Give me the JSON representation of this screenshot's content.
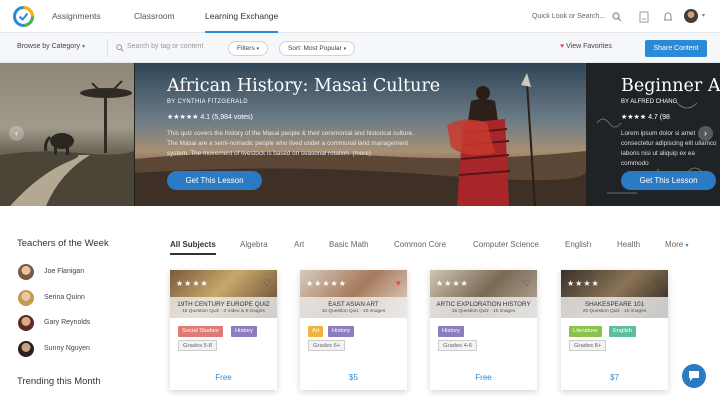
{
  "nav": {
    "tabs": [
      "Assignments",
      "Classroom",
      "Learning Exchange"
    ],
    "search_placeholder": "Quick Look or Search..."
  },
  "toolbar": {
    "browse": "Browse by Category",
    "search_placeholder": "Search by tag or content",
    "filters": "Filters",
    "sort": "Sort: Most Popular",
    "favorites": "View Favorites",
    "share": "Share Content"
  },
  "featured": {
    "title": "African History: Masai Culture",
    "author": "BY CYNTHIA FITZGERALD",
    "rating": "4.1 (5,984 votes)",
    "stars": "★★★★★",
    "description": "This quiz covers the history of the Masai people & their ceremonial and historical culture. The Masai are a semi-nomadic people who lived under a communal land management system. The movement of livestock is based on seasonal rotation. (more)",
    "button": "Get This Lesson",
    "next_title": "Beginner Al",
    "next_author": "BY ALFRED CHANG",
    "next_stars": "★★★★",
    "next_rating": "4.7 (98",
    "next_desc": "Lorem ipsum dolor si amet consectetur adipiscing elit ullamco laboris nisi ut aliquip ex ea commodo",
    "next_button": "Get This Lesson"
  },
  "teachers": {
    "heading": "Teachers of the Week",
    "names": [
      "Joe Flanigan",
      "Serina Quinn",
      "Gary Reynolds",
      "Sunny Nguyen"
    ]
  },
  "trending": {
    "heading": "Trending this Month"
  },
  "subjects": [
    "All Subjects",
    "Algebra",
    "Art",
    "Basic Math",
    "Common Core",
    "Computer Science",
    "English",
    "Health",
    "More"
  ],
  "cards": [
    {
      "stars": "★★★★",
      "title": "19TH CENTURY EUROPE QUIZ",
      "sub": "15 Question Quiz · 3 Video & 6 images",
      "tags": [
        "Social Studies",
        "History"
      ],
      "grade": "Grades 5-8",
      "price": "Free",
      "tag_colors": [
        "#e07a73",
        "#8e7cc3"
      ],
      "heart_color": "#ffffff"
    },
    {
      "stars": "★★★★★",
      "title": "EAST ASIAN ART",
      "sub": "10 Question Quiz · 10 images",
      "tags": [
        "Art",
        "History"
      ],
      "grade": "Grades 6+",
      "price": "$5",
      "tag_colors": [
        "#f0b43c",
        "#8e7cc3"
      ],
      "heart_color": "#e74c5c"
    },
    {
      "stars": "★★★★",
      "title": "ARTIC EXPLORATION HISTORY",
      "sub": "15 Question Quiz · 10 images",
      "tags": [
        "History"
      ],
      "grade": "Grades 4-6",
      "price": "Free",
      "tag_colors": [
        "#8e7cc3"
      ],
      "heart_color": "#ffffff"
    },
    {
      "stars": "★★★★",
      "title": "SHAKESPEARE 101",
      "sub": "20 Question Quiz · 10 images",
      "tags": [
        "Literature",
        "English"
      ],
      "grade": "Grades 8+",
      "price": "$7",
      "tag_colors": [
        "#8bc34a",
        "#5bbf9f"
      ],
      "heart_color": "#ffffff"
    }
  ],
  "icons": [
    "logo-icon",
    "search-icon",
    "bell-icon",
    "document-icon",
    "heart-icon",
    "chat-icon",
    "chevron-left-icon",
    "chevron-right-icon"
  ],
  "colors": {
    "accent": "#2b8ad8",
    "favorite": "#e74c5c"
  }
}
